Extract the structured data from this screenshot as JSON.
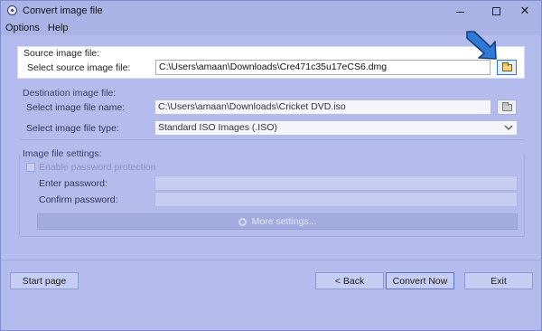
{
  "window": {
    "title": "Convert image file"
  },
  "menu": [
    "Options",
    "Help"
  ],
  "source": {
    "group_label": "Source image file:",
    "field_label": "Select source image file:",
    "path": "C:\\Users\\amaan\\Downloads\\Cre471c35u17eCS6.dmg"
  },
  "destination": {
    "group_label": "Destination image file:",
    "name_label": "Select image file name:",
    "name_value": "C:\\Users\\amaan\\Downloads\\Cricket DVD.iso",
    "type_label": "Select image file type:",
    "type_value": "Standard ISO Images (.ISO)"
  },
  "settings": {
    "group_label": "Image file settings:",
    "password_checkbox_label": "Enable password protection",
    "enter_password_label": "Enter password:",
    "confirm_password_label": "Confirm password:",
    "more_settings_label": "More settings..."
  },
  "footer": {
    "start_page": "Start page",
    "back": "< Back",
    "convert_now": "Convert Now",
    "exit": "Exit"
  },
  "colors": {
    "window_bg": "#b4bced",
    "title_bg": "#aab3e6",
    "accent_arrow": "#2d7bd6"
  },
  "icons": {
    "app": "disc-icon",
    "browse": "folder-open-icon",
    "pointer": "arrow-pointer-icon"
  }
}
